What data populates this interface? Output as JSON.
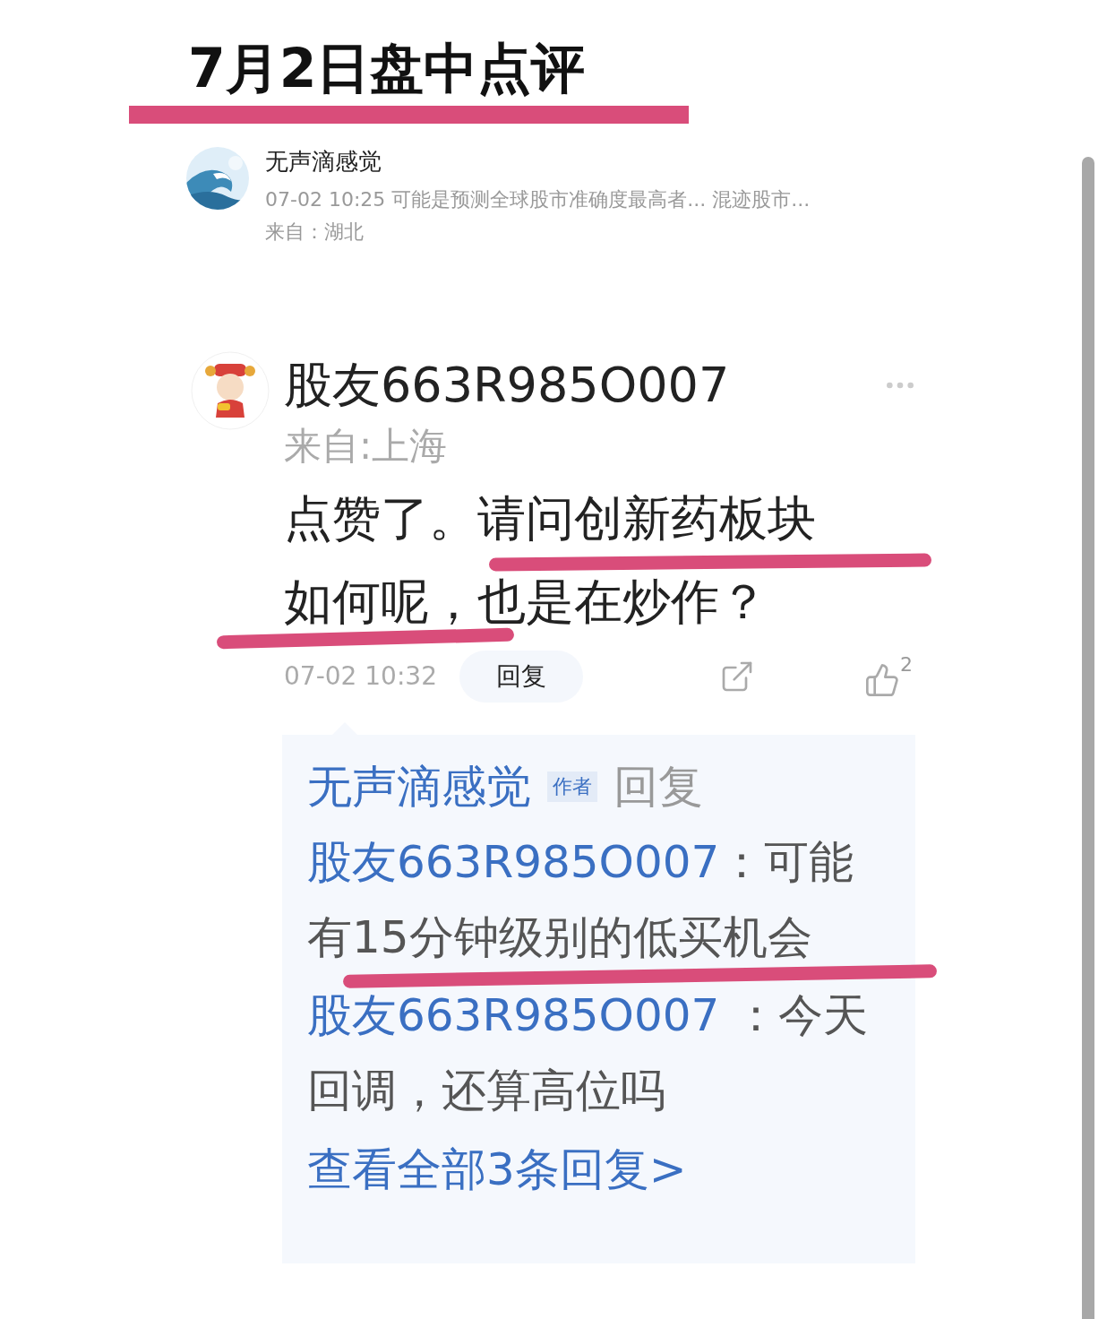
{
  "header": {
    "title": "7月2日盘中点评"
  },
  "post": {
    "author": "无声滴感觉",
    "meta": "07-02 10:25 可能是预测全球股市准确度最高者... 混迹股市...",
    "location": "来自：湖北"
  },
  "comment": {
    "author": "股友663R985O007",
    "location": "来自:上海",
    "body_lines": [
      "点赞了。请问创新药板块",
      "如何呢，也是在炒作？"
    ],
    "time": "07-02 10:32",
    "reply_button": "回复",
    "likes": "2",
    "replies": [
      {
        "author": "无声滴感觉",
        "badge": "作者",
        "verb": "回复",
        "target": "股友663R985O007",
        "separator": "：",
        "text_lines": [
          "可能",
          "有15分钟级别的低买机会"
        ]
      },
      {
        "author": "股友663R985O007",
        "separator": " ：",
        "text_lines": [
          "今天",
          "回调，还算高位吗"
        ]
      }
    ],
    "more_link": "查看全部3条回复>"
  }
}
